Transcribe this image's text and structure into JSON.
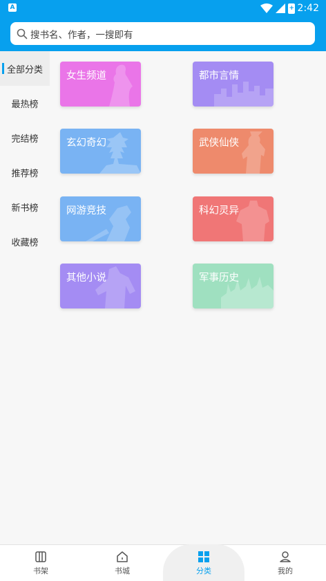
{
  "status_bar": {
    "time": "2:42",
    "left_badge": "A",
    "battery_badge": "+"
  },
  "search": {
    "placeholder": "搜书名、作者，一搜即有"
  },
  "sidebar": {
    "items": [
      {
        "label": "全部分类",
        "active": true
      },
      {
        "label": "最热榜"
      },
      {
        "label": "完结榜"
      },
      {
        "label": "推荐榜"
      },
      {
        "label": "新书榜"
      },
      {
        "label": "收藏榜"
      }
    ]
  },
  "categories": [
    {
      "label": "女生频道",
      "color": "#ea75e8"
    },
    {
      "label": "都市言情",
      "color": "#a48cf3"
    },
    {
      "label": "玄幻奇幻",
      "color": "#79b3f3"
    },
    {
      "label": "武侠仙侠",
      "color": "#ee8a6c"
    },
    {
      "label": "网游竞技",
      "color": "#79b3f3"
    },
    {
      "label": "科幻灵异",
      "color": "#f07676"
    },
    {
      "label": "其他小说",
      "color": "#a48cf3"
    },
    {
      "label": "军事历史",
      "color": "#9fe0c0"
    }
  ],
  "bottom_nav": {
    "items": [
      {
        "label": "书架",
        "icon": "bookshelf-icon"
      },
      {
        "label": "书城",
        "icon": "home-icon"
      },
      {
        "label": "分类",
        "icon": "category-grid-icon",
        "active": true
      },
      {
        "label": "我的",
        "icon": "user-icon"
      }
    ]
  },
  "colors": {
    "accent": "#07a0ee"
  }
}
